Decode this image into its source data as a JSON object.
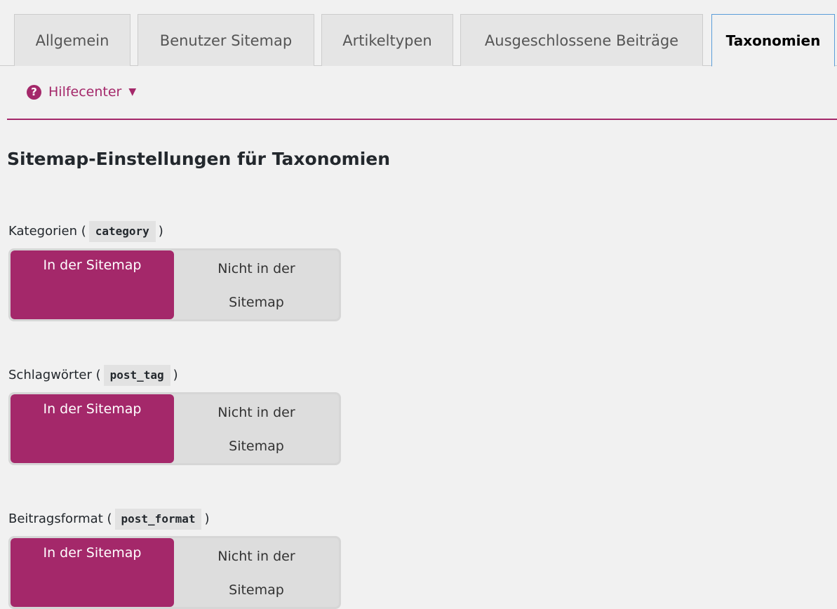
{
  "tabs": [
    {
      "label": "Allgemein",
      "active": false
    },
    {
      "label": "Benutzer Sitemap",
      "active": false
    },
    {
      "label": "Artikeltypen",
      "active": false
    },
    {
      "label": "Ausgeschlossene Beiträge",
      "active": false
    },
    {
      "label": "Taxonomien",
      "active": true
    }
  ],
  "help": {
    "label": "Hilfecenter",
    "icon": "question-circle-icon",
    "arrow": "▼",
    "color": "#a4286a"
  },
  "heading": "Sitemap-Einstellungen für Taxonomien",
  "settings": [
    {
      "label": "Kategorien (",
      "slug": "category",
      "label_close": ")",
      "on_label": "In der Sitemap",
      "off_label_line1": "Nicht in der",
      "off_label_line2": "Sitemap",
      "selected": "on"
    },
    {
      "label": "Schlagwörter (",
      "slug": "post_tag",
      "label_close": ")",
      "on_label": "In der Sitemap",
      "off_label_line1": "Nicht in der",
      "off_label_line2": "Sitemap",
      "selected": "on"
    },
    {
      "label": "Beitragsformat (",
      "slug": "post_format",
      "label_close": ")",
      "on_label": "In der Sitemap",
      "off_label_line1": "Nicht in der",
      "off_label_line2": "Sitemap",
      "selected": "on"
    }
  ],
  "colors": {
    "accent": "#a4286a",
    "toggle_off_bg": "#dddddd",
    "active_tab_border": "#5b9dd9"
  }
}
